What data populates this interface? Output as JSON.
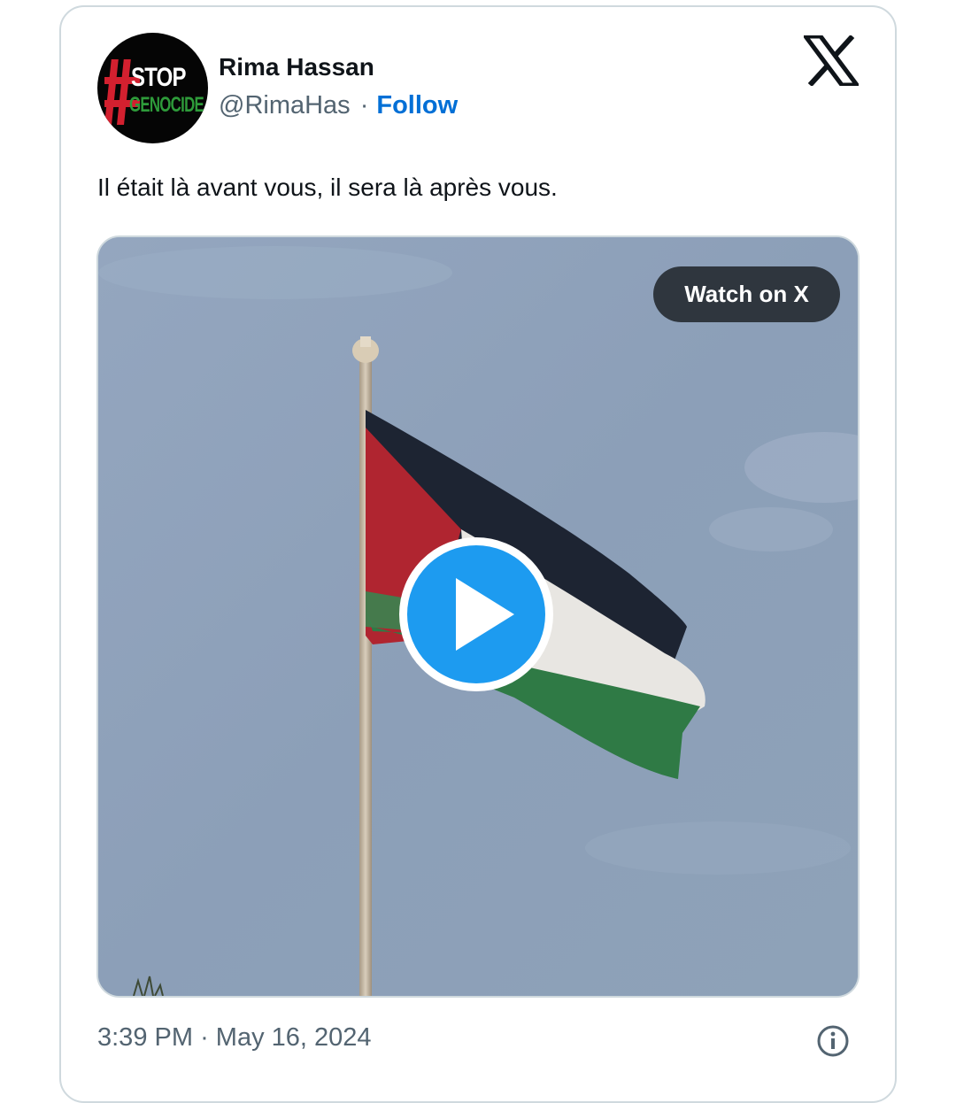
{
  "author": {
    "name": "Rima Hassan",
    "handle": "@RimaHas",
    "separator": "·",
    "follow_label": "Follow",
    "avatar": {
      "line1": "STOP",
      "line2": "GENOCIDE",
      "icon": "hashtag-stop-genocide-avatar"
    }
  },
  "tweet": {
    "text": "Il était là avant vous, il sera là après vous.",
    "media": {
      "type": "video",
      "watch_label": "Watch on X",
      "play_icon": "play-icon"
    },
    "time": "3:39 PM",
    "date_separator": "·",
    "date": "May 16, 2024"
  },
  "icons": {
    "brand": "x-logo-icon",
    "info": "info-icon"
  },
  "colors": {
    "follow": "#006fd6",
    "play_button": "#1d9bf0",
    "secondary_text": "#536471",
    "border": "#cfd9de"
  }
}
